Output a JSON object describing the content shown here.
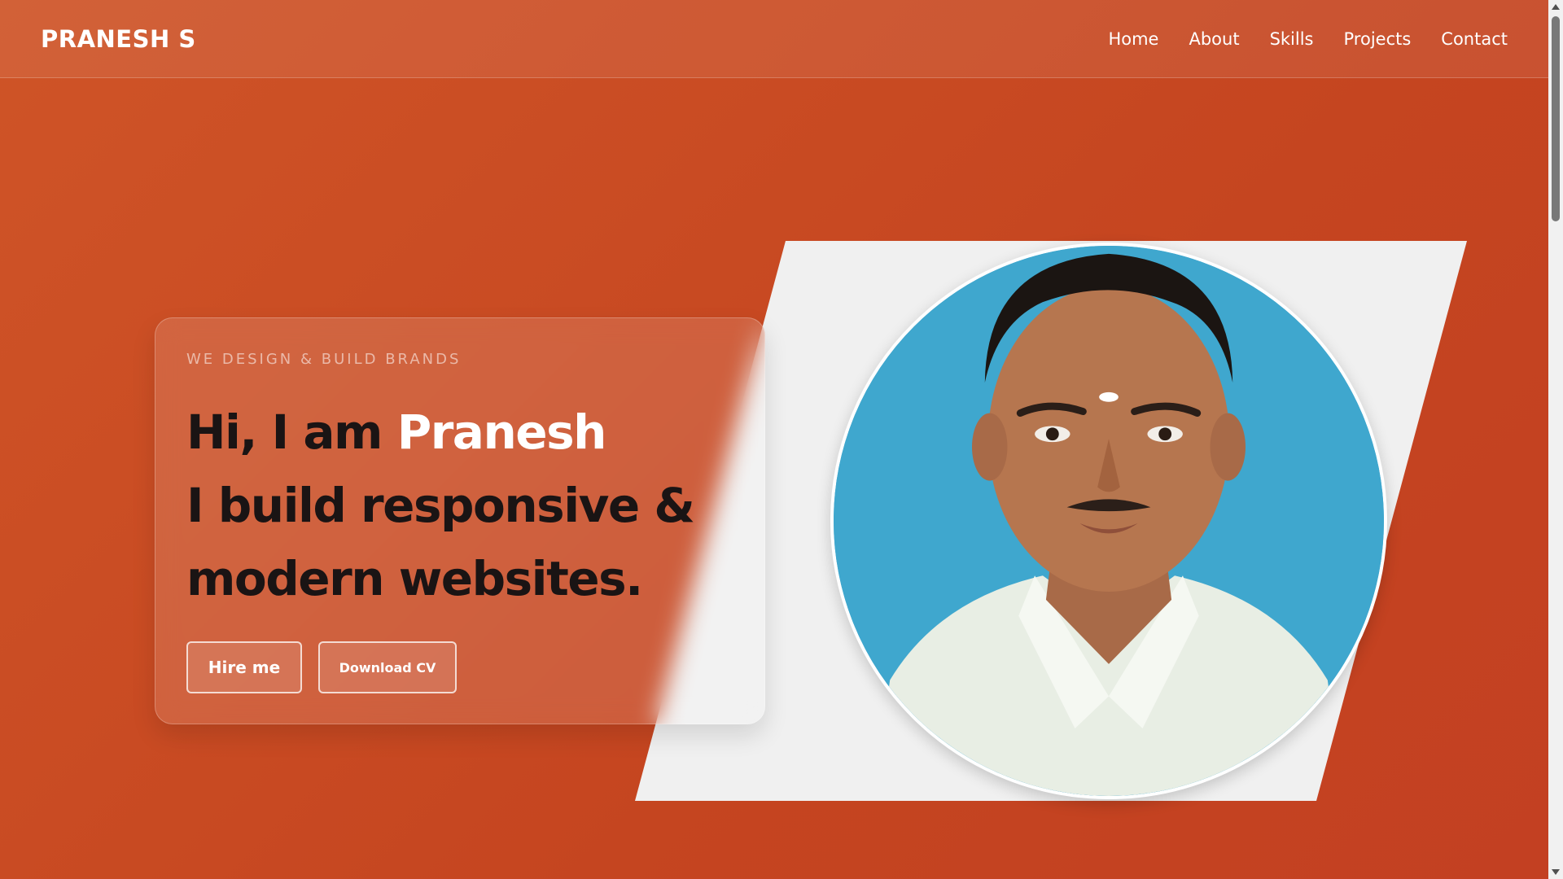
{
  "navbar": {
    "logo": "PRANESH S",
    "links": [
      "Home",
      "About",
      "Skills",
      "Projects",
      "Contact"
    ]
  },
  "hero": {
    "tagline": "WE DESIGN & BUILD BRANDS",
    "greeting": "Hi, I am ",
    "name": "Pranesh",
    "line2": "I build responsive &",
    "line3": "modern websites.",
    "hire_button": "Hire me",
    "cv_button": "Download CV"
  },
  "colors": {
    "accent_bg": "#c9461f",
    "panel": "#f0f0f0",
    "photo_bg": "#3fa7ce",
    "text_dark": "#1a1414"
  },
  "icons": [
    "scroll-up-arrow-icon",
    "scroll-down-arrow-icon"
  ]
}
